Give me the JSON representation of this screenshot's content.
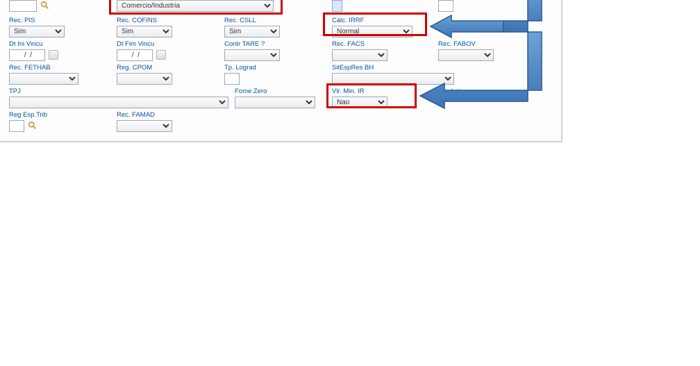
{
  "row0": {
    "col1_input": "",
    "col2_select": "Comercio/Industria",
    "col4_input": "",
    "col5_input": ""
  },
  "row1": {
    "rec_pis_label": "Rec. PIS",
    "rec_pis_value": "Sim",
    "rec_cofins_label": "Rec. COFINS",
    "rec_cofins_value": "Sim",
    "rec_csll_label": "Rec. CSLL",
    "rec_csll_value": "Sim",
    "calc_irrf_label": "Cálc. IRRF",
    "calc_irrf_value": "Normal"
  },
  "row2": {
    "dt_ini_label": "Dt Ini Vincu",
    "dt_ini_value": " /  /",
    "dt_fim_label": "Dt Fim Vincu",
    "dt_fim_value": " /  /",
    "contr_tare_label": "Contr TARE ?",
    "contr_tare_value": "",
    "rec_facs_label": "Rec. FACS",
    "rec_facs_value": "",
    "rec_fabov_label": "Rec. FABOV",
    "rec_fabov_value": ""
  },
  "row3": {
    "rec_fethab_label": "Rec. FETHAB",
    "rec_fethab_value": "",
    "reg_cpom_label": "Reg. CPOM",
    "reg_cpom_value": "",
    "tp_lograd_label": "Tp. Lograd",
    "tp_lograd_value": "",
    "sitespres_label": "SitEspRes BH",
    "sitespres_value": ""
  },
  "row4": {
    "tpj_label": "TPJ",
    "tpj_value": "",
    "fome_zero_label": "Fome Zero",
    "fome_zero_value": "",
    "vlr_min_ir_label": "Vlr. Min. IR",
    "vlr_min_ir_value": "Nao",
    "lei_label": "Lei"
  },
  "row5": {
    "reg_esp_trib_label": "Reg Esp.Trib",
    "reg_esp_trib_value": "",
    "rec_famad_label": "Rec. FAMAD",
    "rec_famad_value": ""
  }
}
